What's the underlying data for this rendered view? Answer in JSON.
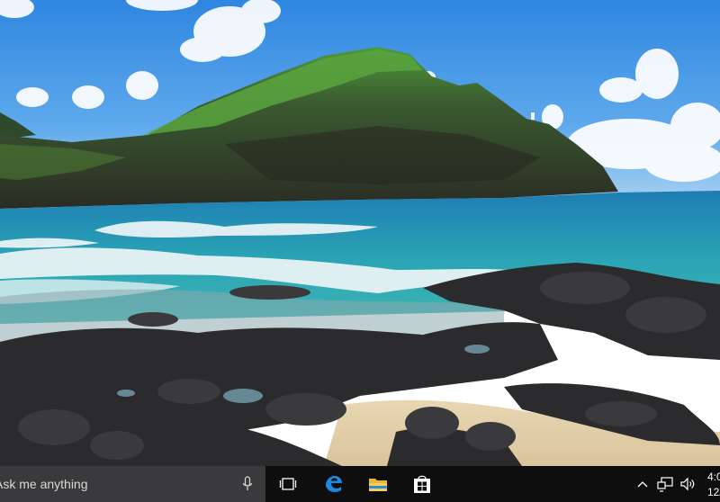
{
  "taskbar": {
    "search_placeholder": "Ask me anything",
    "icons": [
      "task-view-icon",
      "edge-icon",
      "file-explorer-icon",
      "store-icon"
    ],
    "tray_icons": [
      "chevron-up-icon",
      "network-icon",
      "volume-icon"
    ],
    "clock_time": "4:0",
    "clock_date": "12/"
  }
}
